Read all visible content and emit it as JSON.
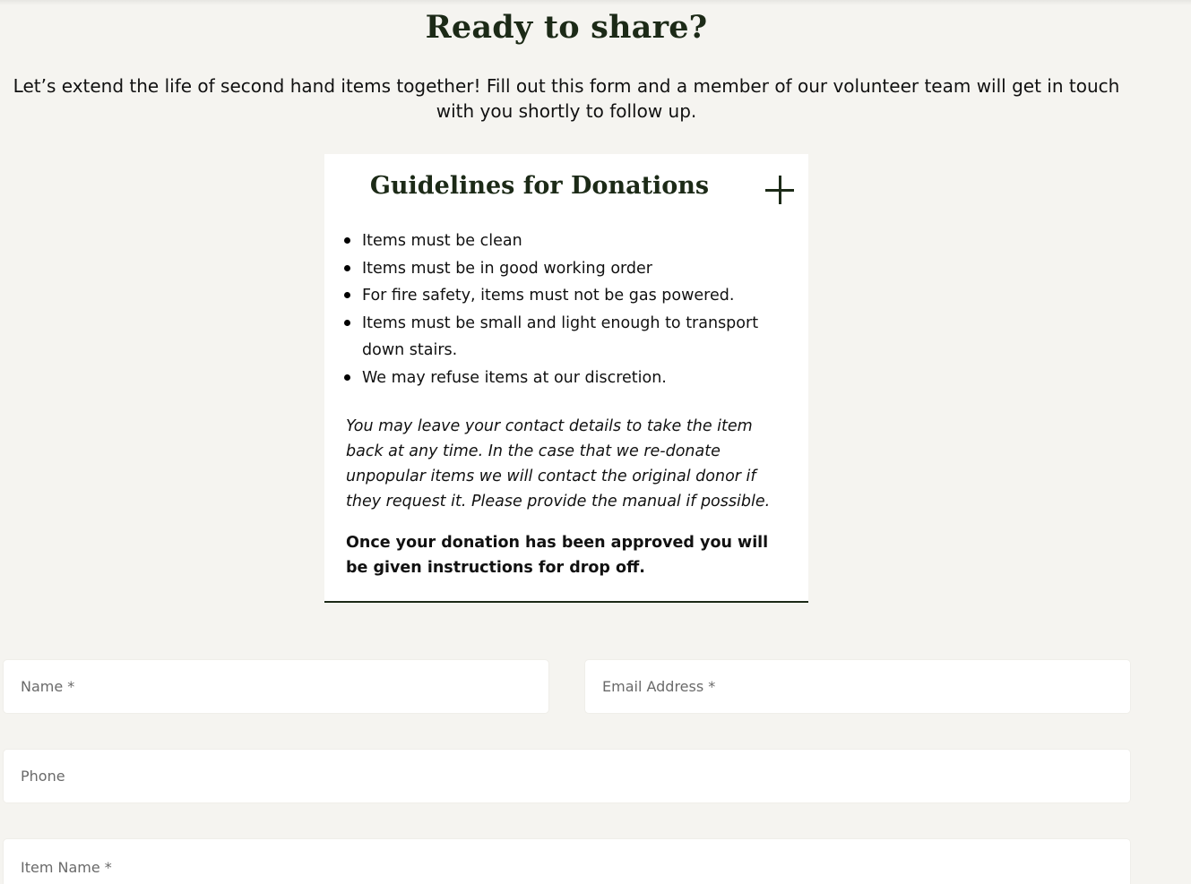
{
  "header": {
    "title": "Ready to share?",
    "intro": "Let’s extend the life of second hand items together! Fill out this form and a member of our volunteer team will get in touch with you shortly to follow up."
  },
  "guidelines": {
    "title": "Guidelines for Donations",
    "toggle_icon": "plus-icon",
    "rules": [
      "Items must be clean",
      "Items must be in good working order",
      "For fire safety, items must not be gas powered.",
      "Items must be small and light enough to transport down stairs.",
      "We may refuse items at our discretion."
    ],
    "note_italic": "You may leave your contact details to take the item back at any time. In the case that we re-donate unpopular items we will contact the original donor if they request it. Please provide the manual if possible.",
    "note_bold": "Once your donation has been approved you will be given instructions for drop off."
  },
  "form": {
    "name_placeholder": "Name *",
    "email_placeholder": "Email Address *",
    "phone_placeholder": "Phone",
    "item_placeholder": "Item Name *"
  },
  "colors": {
    "background": "#f5f4f0",
    "heading": "#1c2a17",
    "card": "#ffffff"
  }
}
